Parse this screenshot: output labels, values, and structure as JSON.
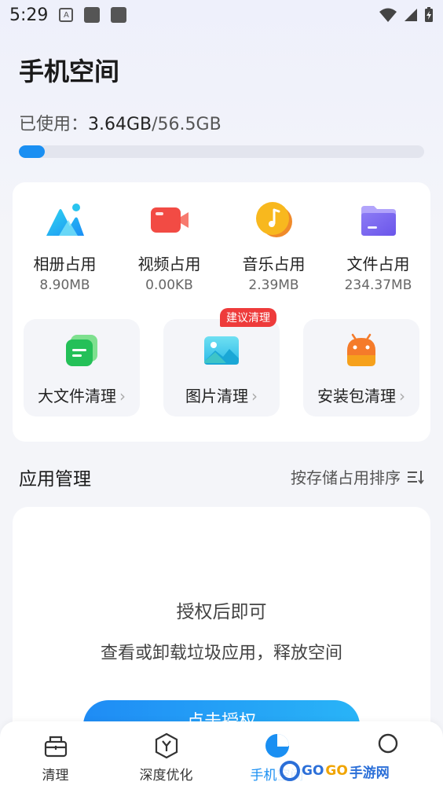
{
  "status_bar": {
    "time": "5:29",
    "note_letter": "A"
  },
  "page": {
    "title": "手机空间"
  },
  "usage": {
    "label": "已使用：",
    "used": "3.64GB",
    "total": "/56.5GB",
    "fraction": 0.064
  },
  "categories": [
    {
      "label": "相册占用",
      "size": "8.90MB",
      "icon": "photo-album-icon"
    },
    {
      "label": "视频占用",
      "size": "0.00KB",
      "icon": "video-icon"
    },
    {
      "label": "音乐占用",
      "size": "2.39MB",
      "icon": "music-icon"
    },
    {
      "label": "文件占用",
      "size": "234.37MB",
      "icon": "folder-icon"
    }
  ],
  "clean_tools": [
    {
      "label": "大文件清理",
      "chevron": "›",
      "icon": "large-file-icon"
    },
    {
      "label": "图片清理",
      "chevron": "›",
      "badge": "建议清理",
      "icon": "picture-icon"
    },
    {
      "label": "安装包清理",
      "chevron": "›",
      "icon": "android-package-icon"
    }
  ],
  "app_manage": {
    "title": "应用管理",
    "sort_label": "按存储占用排序",
    "auth_title": "授权后即可",
    "auth_subtitle": "查看或卸载垃圾应用，释放空间",
    "auth_button": "点击授权"
  },
  "nav": [
    {
      "label": "清理",
      "icon": "broom-box-icon"
    },
    {
      "label": "深度优化",
      "icon": "shield-y-icon"
    },
    {
      "label": "手机空间",
      "icon": "pie-chart-icon",
      "active": true
    },
    {
      "label": "",
      "icon": "circle-icon"
    }
  ],
  "watermark": {
    "brand_blue": "GO",
    "brand_gold": "GO",
    "suffix": "手游网"
  },
  "colors": {
    "accent": "#1a8ff2",
    "badge": "#ee3b3b"
  }
}
